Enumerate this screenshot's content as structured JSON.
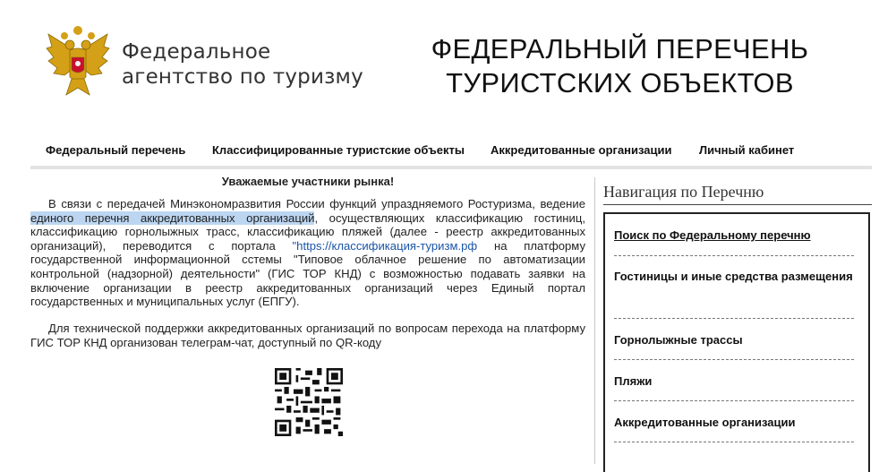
{
  "header": {
    "agency_line1": "Федеральное",
    "agency_line2": "агентство по туризму",
    "title_line1": "ФЕДЕРАЛЬНЫЙ ПЕРЕЧЕНЬ",
    "title_line2": "ТУРИСТСКИХ ОБЪЕКТОВ"
  },
  "nav": {
    "items": [
      {
        "label": "Федеральный перечень"
      },
      {
        "label": "Классифицированные туристские объекты"
      },
      {
        "label": "Аккредитованные организации"
      },
      {
        "label": "Личный кабинет"
      }
    ]
  },
  "notice": {
    "title": "Уважаемые участники рынка!",
    "p1_part1": "В связи с передачей Минэкономразвития России функций упраздняемого Ростуризма, ведение ",
    "p1_highlight": "единого перечня аккредитованных организаций",
    "p1_part2": ", осуществляющих классификацию гостиниц, классификацию горнолыжных трасс, классификацию пляжей (далее - реестр аккредитованных организаций), переводится с портала ",
    "p1_link": "\"https://классификация-туризм.рф",
    "p1_part3": " на платформу государственной информационной сстемы \"Типовое облачное решение по автоматизации контрольной (надзорной) деятельности\" (ГИС ТОР КНД) с возможностью подавать заявки на включение организации в реестр аккредитованных организаций через Единый портал государственных и муниципальных услуг (ЕПГУ).",
    "p2": "Для технической поддержки аккредитованных организаций по вопросам перехода на платформу ГИС ТОР КНД организован телеграм-чат, доступный по QR-коду"
  },
  "sidebar": {
    "title": "Навигация по Перечню",
    "items": [
      {
        "label": "Поиск по Федеральному перечню"
      },
      {
        "label": "Гостиницы и иные средства размещения"
      },
      {
        "label": "Горнолыжные трассы"
      },
      {
        "label": "Пляжи"
      },
      {
        "label": "Аккредитованные организации"
      }
    ]
  },
  "colors": {
    "highlight": "#bcd6f2",
    "link": "#1a55a8",
    "emblem_gold": "#d4a017",
    "emblem_red": "#c8102e"
  }
}
